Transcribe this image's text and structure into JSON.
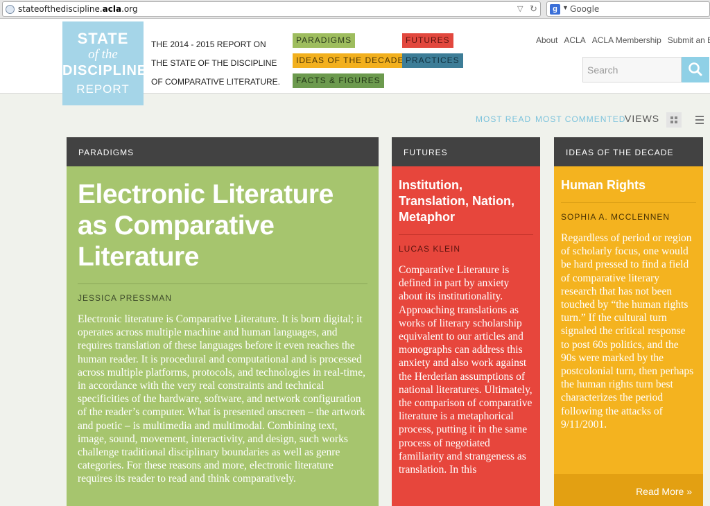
{
  "browser": {
    "url_domain": "stateofthediscipline.",
    "url_bold": "acla",
    "url_tail": ".org",
    "search_engine": "Google"
  },
  "header": {
    "logo": {
      "line1": "STATE",
      "line2": "of the",
      "line3": "DISCIPLINE",
      "line4": "REPORT"
    },
    "tagline": "THE 2014 - 2015 REPORT ON THE STATE OF THE DISCIPLINE OF COMPARATIVE LITERATURE.",
    "nav": {
      "paradigms": "PARADIGMS",
      "futures": "FUTURES",
      "ideas": "IDEAS OF THE DECADE",
      "practices": "PRACTICES",
      "facts": "FACTS & FIGURES"
    },
    "links": [
      "About",
      "ACLA",
      "ACLA Membership",
      "Submit an Entry"
    ],
    "search_placeholder": "Search"
  },
  "views_bar": {
    "most_read": "MOST READ",
    "most_commented": "MOST COMMENTED",
    "views": "VIEWS"
  },
  "cards": [
    {
      "category": "PARADIGMS",
      "title": "Electronic Literature as Comparative Literature",
      "author": "JESSICA PRESSMAN",
      "excerpt": "Electronic literature is Comparative Literature. It is born digital; it operates across multiple machine and human languages, and requires translation of these languages before it even reaches the human reader. It is procedural and computational and is processed across multiple platforms, protocols, and technologies in real-time, in accordance with the very real constraints and technical specificities of the hardware, software, and network configuration of the reader’s computer. What is presented onscreen – the artwork and poetic – is multimedia and multimodal. Combining text, image, sound, movement, interactivity, and design, such works challenge traditional disciplinary boundaries as well as genre categories. For these reasons and more, electronic literature requires its reader to read and think comparatively."
    },
    {
      "category": "FUTURES",
      "title": "Institution, Translation, Nation, Metaphor",
      "author": "LUCAS KLEIN",
      "excerpt": "Comparative Literature is defined in part by anxiety about its institutionality. Approaching translations as works of literary scholarship equivalent to our articles and monographs can address this anxiety and also work against the Herderian assumptions of national literatures. Ultimately, the comparison of comparative literature is a metaphorical process, putting it in the same process of negotiated familiarity and strangeness as translation. In this"
    },
    {
      "category": "IDEAS OF THE DECADE",
      "title": "Human Rights",
      "author": "SOPHIA A. MCCLENNEN",
      "excerpt": "Regardless of period or region of scholarly focus, one would be hard pressed to find a field of comparative literary research that has not been touched by “the human rights turn.” If the cultural turn signaled the critical response to post 60s politics, and the 90s were marked by the postcolonial turn, then perhaps the human rights turn best characterizes the period following the attacks of 9/11/2001.",
      "read_more": "Read More »"
    }
  ],
  "colors": {
    "paradigms": "#a6c56e",
    "futures": "#e7463c",
    "ideas": "#f4b31f",
    "practices": "#3d7d97",
    "facts": "#6c9a4e",
    "logo": "#a5d5e8",
    "card_header": "#424242"
  }
}
